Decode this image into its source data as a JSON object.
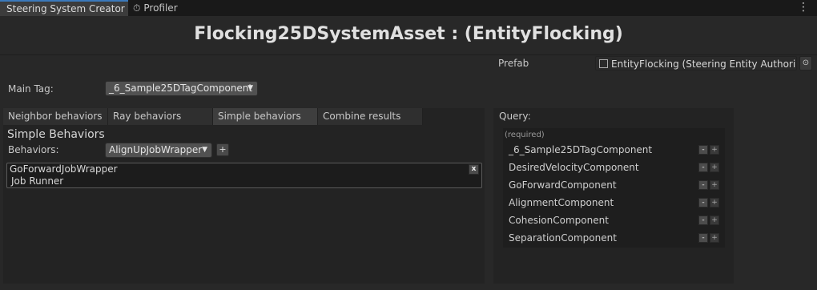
{
  "window": {
    "active_tab": "Steering System Creator",
    "other_tab": "Profiler",
    "other_tab_icon": "stopwatch-icon",
    "menu_icon": "⋮"
  },
  "title": "Flocking25DSystemAsset :  (EntityFlocking)",
  "prefab": {
    "label": "Prefab",
    "value": "EntityFlocking (Steering Entity Authoring)",
    "pick_icon": "⊙"
  },
  "main_tag": {
    "label": "Main Tag:",
    "value": "_6_Sample25DTagComponent"
  },
  "tabs": [
    "Neighbor behaviors",
    "Ray behaviors",
    "Simple behaviors",
    "Combine results"
  ],
  "selected_tab": "Simple behaviors",
  "simple": {
    "title": "Simple Behaviors",
    "behaviors_label": "Behaviors:",
    "behaviors_value": "AlignUpJobWrapper",
    "add_label": "+",
    "item": {
      "name": "GoForwardJobWrapper",
      "sub": "Job Runner",
      "remove_label": "x"
    }
  },
  "query": {
    "label": "Query:",
    "required_label": "(required)",
    "minus_label": "-",
    "plus_label": "+",
    "components": [
      "_6_Sample25DTagComponent",
      "DesiredVelocityComponent",
      "GoForwardComponent",
      "AlignmentComponent",
      "CohesionComponent",
      "SeparationComponent"
    ]
  },
  "colors": {
    "background": "#282828",
    "tab_accent": "#3a79bb",
    "panel": "#232323"
  }
}
